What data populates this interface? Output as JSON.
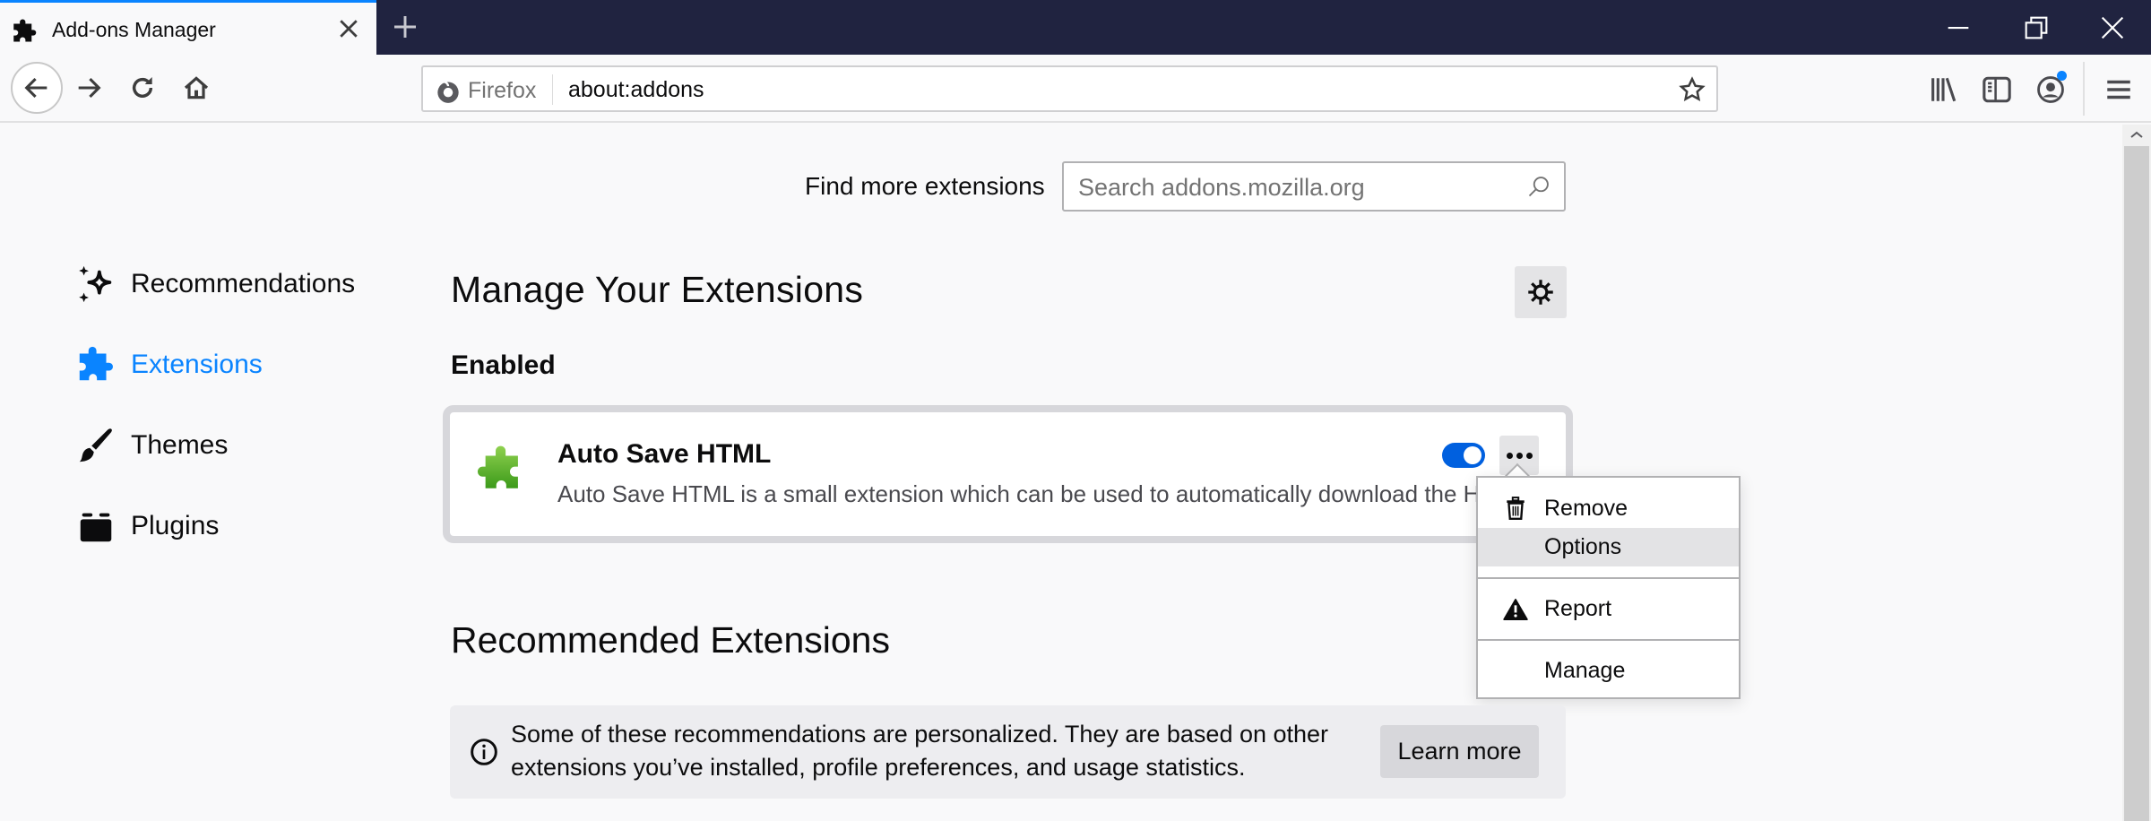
{
  "browser": {
    "tab": {
      "title": "Add-ons Manager",
      "icon": "puzzle-icon"
    },
    "url_identity": "Firefox",
    "url": "about:addons",
    "colors": {
      "accent": "#0a84ff",
      "tabbar_bg": "#202340",
      "toggle_on": "#0060df",
      "account_badge": "#0a84ff"
    }
  },
  "search": {
    "label": "Find more extensions",
    "placeholder": "Search addons.mozilla.org"
  },
  "sidebar": {
    "items": [
      {
        "label": "Recommendations",
        "icon": "sparkle-icon",
        "active": false
      },
      {
        "label": "Extensions",
        "icon": "puzzle-icon",
        "active": true
      },
      {
        "label": "Themes",
        "icon": "paintbrush-icon",
        "active": false
      },
      {
        "label": "Plugins",
        "icon": "plugin-block-icon",
        "active": false
      }
    ]
  },
  "main": {
    "title": "Manage Your Extensions",
    "enabled_heading": "Enabled",
    "extension": {
      "name": "Auto Save HTML",
      "description": "Auto Save HTML is a small extension which can be used to automatically download the H",
      "enabled": true
    },
    "menu": {
      "items": [
        {
          "label": "Remove",
          "icon": "trash-icon"
        },
        {
          "label": "Options",
          "icon": ""
        },
        {
          "label": "Report",
          "icon": "warning-icon"
        },
        {
          "label": "Manage",
          "icon": ""
        }
      ]
    },
    "recommended_title": "Recommended Extensions",
    "notice": {
      "text": "Some of these recommendations are personalized. They are based on other extensions you’ve installed, profile preferences, and usage statistics.",
      "button": "Learn more"
    }
  }
}
